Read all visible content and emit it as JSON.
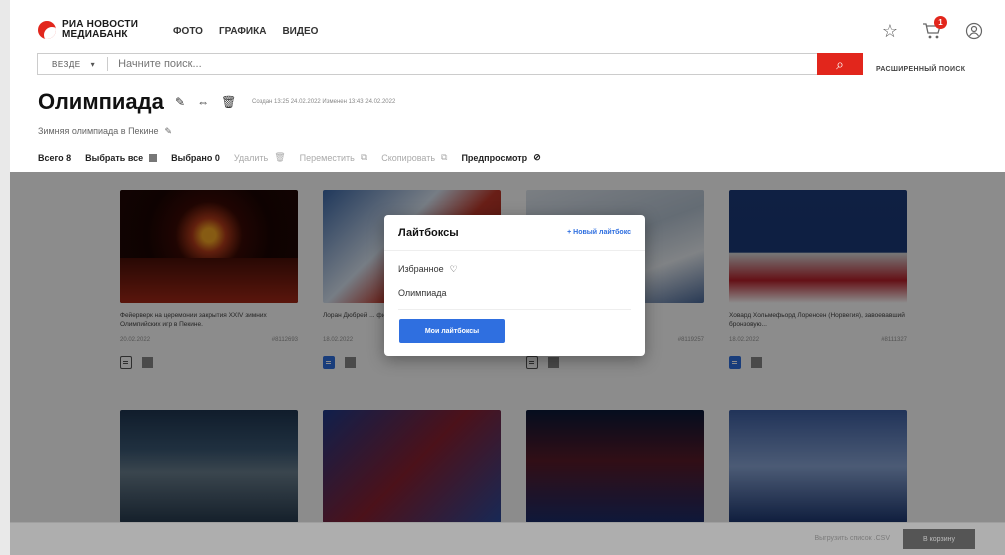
{
  "header": {
    "logo_line1": "РИА НОВОСТИ",
    "logo_line2": "МЕДИАБАНК",
    "nav": [
      "ФОТО",
      "ГРАФИКА",
      "ВИДЕО"
    ],
    "cart_count": "1"
  },
  "search": {
    "scope": "ВЕЗДЕ",
    "placeholder": "Начните поиск...",
    "advanced": "РАСШИРЕННЫЙ ПОИСК"
  },
  "lightbox": {
    "title": "Олимпиада",
    "meta": "Создан 13:25 24.02.2022  Изменен 13:43 24.02.2022",
    "description": "Зимняя олимпиада в Пекине"
  },
  "toolbar": {
    "total": "Всего 8",
    "select_all": "Выбрать все",
    "selected": "Выбрано 0",
    "delete": "Удалить",
    "move": "Переместить",
    "copy": "Скопировать",
    "preview": "Предпросмотр"
  },
  "cards": [
    {
      "caption": "Фейерверк на церемонии закрытия XXIV зимних Олимпийских игр в Пекине.",
      "date": "20.02.2022",
      "id": "#8112693"
    },
    {
      "caption": "Лоран Дюбрей ... финиша в заб...",
      "date": "18.02.2022",
      "id": ""
    },
    {
      "caption": "...станции ... мужчин а...",
      "date": "",
      "id": "#8119257"
    },
    {
      "caption": "Ховард Хольмефьорд Лоренсен (Норвегия), завоевавший бронзовую...",
      "date": "18.02.2022",
      "id": "#8111327"
    }
  ],
  "modal": {
    "title": "Лайтбоксы",
    "new_label": "+ Новый лайтбокс",
    "items": [
      "Избранное",
      "Олимпиада"
    ],
    "button": "Мои лайтбоксы"
  },
  "bottom": {
    "export": "Выгрузить список .CSV",
    "to_cart": "В корзину"
  },
  "colors": {
    "accent_red": "#e2261c",
    "accent_blue": "#2f6fe0"
  }
}
